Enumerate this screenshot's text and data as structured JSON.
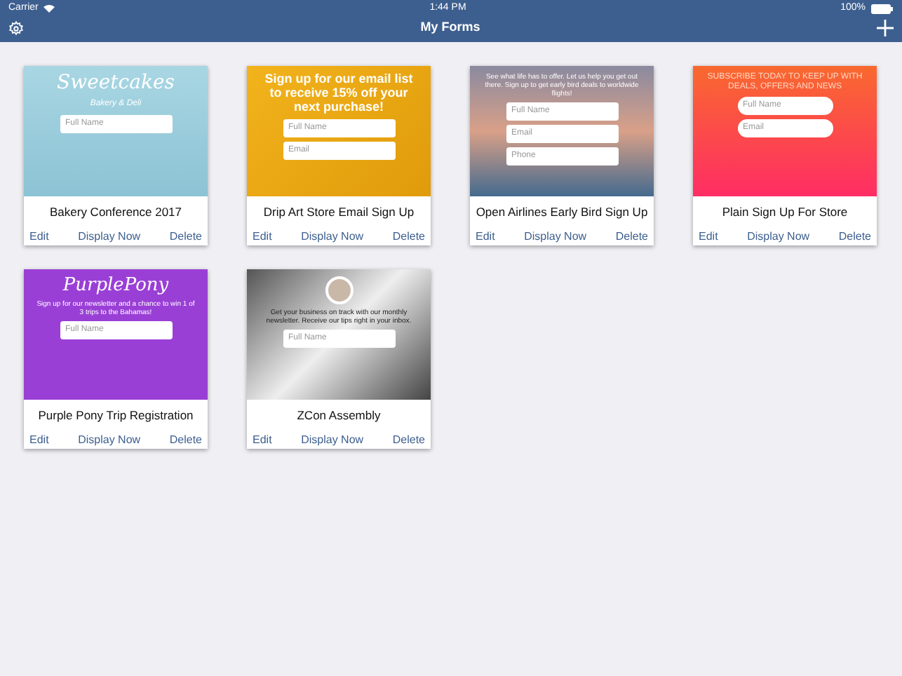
{
  "status_bar": {
    "carrier": "Carrier",
    "time": "1:44 PM",
    "battery": "100%"
  },
  "nav": {
    "title": "My Forms"
  },
  "forms": [
    {
      "title": "Bakery Conference 2017",
      "preview": {
        "heading": "Sweetcakes",
        "subheading": "Bakery & Deli",
        "fields": [
          "Full Name"
        ]
      },
      "actions": [
        "Edit",
        "Display Now",
        "Delete"
      ]
    },
    {
      "title": "Drip Art Store Email Sign Up",
      "preview": {
        "heading": "Sign up for our email list to receive 15% off your next purchase!",
        "fields": [
          "Full Name",
          "Email"
        ]
      },
      "actions": [
        "Edit",
        "Display Now",
        "Delete"
      ]
    },
    {
      "title": "Open Airlines Early Bird Sign Up",
      "preview": {
        "text": "See what life has to offer. Let us help you get out there. Sign up to get early bird deals to worldwide flights!",
        "fields": [
          "Full Name",
          "Email",
          "Phone"
        ]
      },
      "actions": [
        "Edit",
        "Display Now",
        "Delete"
      ]
    },
    {
      "title": "Plain Sign Up For Store",
      "preview": {
        "text": "SUBSCRIBE TODAY TO KEEP UP WITH DEALS, OFFERS AND NEWS",
        "fields": [
          "Full Name",
          "Email"
        ]
      },
      "actions": [
        "Edit",
        "Display Now",
        "Delete"
      ]
    },
    {
      "title": "Purple Pony Trip Registration",
      "preview": {
        "heading": "PurplePony",
        "text": "Sign up for our newsletter and a chance to win 1 of 3 trips to the Bahamas!",
        "fields": [
          "Full Name"
        ]
      },
      "actions": [
        "Edit",
        "Display Now",
        "Delete"
      ]
    },
    {
      "title": "ZCon Assembly",
      "preview": {
        "avatar": true,
        "text": "Get your business on track with our monthly newsletter. Receive our tips right in your inbox.",
        "fields": [
          "Full Name"
        ]
      },
      "actions": [
        "Edit",
        "Display Now",
        "Delete"
      ]
    }
  ]
}
